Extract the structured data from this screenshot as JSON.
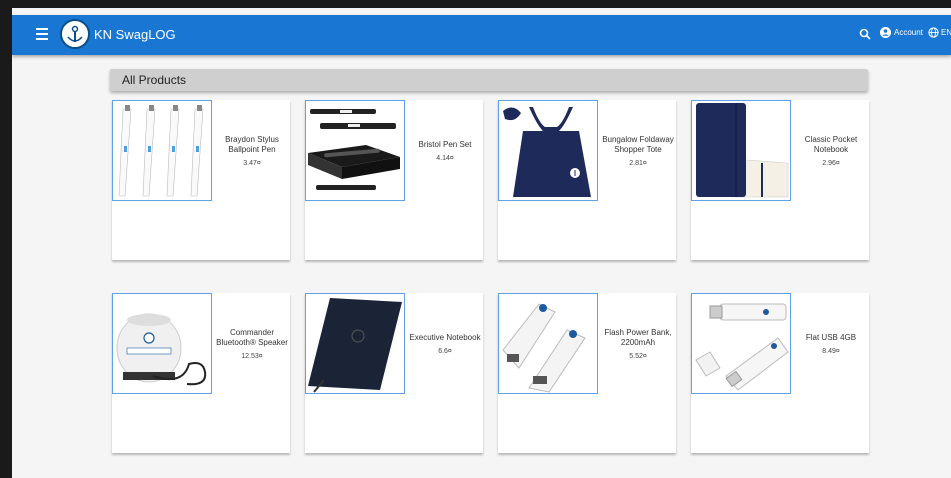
{
  "app": {
    "title": "KN SwagLOG",
    "account_label": "Account",
    "language_label": "EN"
  },
  "section": {
    "title": "All Products"
  },
  "products": [
    {
      "name": "Braydon Stylus Ballpoint Pen",
      "price": "3.47¤"
    },
    {
      "name": "Bristol Pen Set",
      "price": "4.14¤"
    },
    {
      "name": "Bungalow Foldaway Shopper Tote",
      "price": "2.81¤"
    },
    {
      "name": "Classic Pocket Notebook",
      "price": "2.96¤"
    },
    {
      "name": "Commander Bluetooth® Speaker",
      "price": "12.53¤"
    },
    {
      "name": "Executive Notebook",
      "price": "6.6¤"
    },
    {
      "name": "Flash Power Bank, 2200mAh",
      "price": "5.52¤"
    },
    {
      "name": "Flat USB 4GB",
      "price": "8.49¤"
    }
  ],
  "colors": {
    "appbar": "#1976d2",
    "thumb_border": "#5ea3e6",
    "product_navy": "#1e2a5a"
  },
  "icons": [
    "menu-icon",
    "anchor-logo-icon",
    "search-icon",
    "account-icon",
    "globe-icon"
  ]
}
